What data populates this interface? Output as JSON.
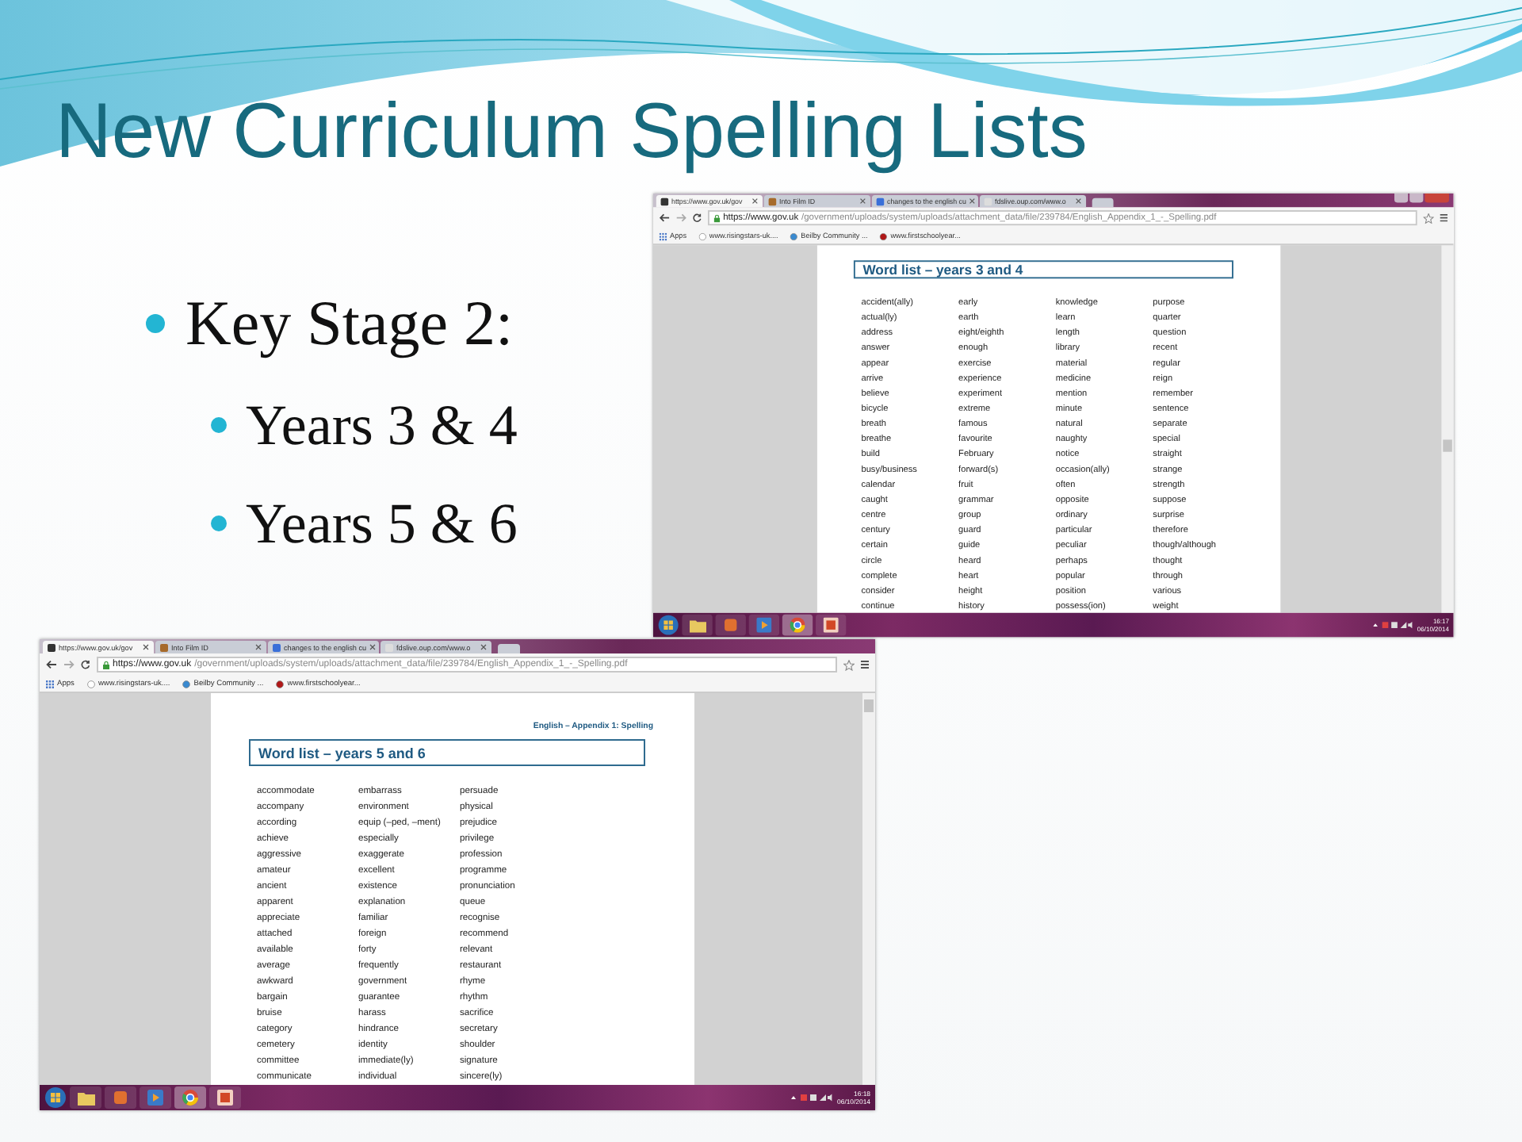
{
  "slide": {
    "title": "New Curriculum Spelling Lists",
    "bullets": [
      {
        "text": "Key Stage 2:",
        "children": [
          {
            "text": "Years 3 & 4"
          },
          {
            "text": "Years 5 & 6"
          }
        ]
      }
    ]
  },
  "screenshots": [
    {
      "window_controls": true,
      "tabs": [
        {
          "label": "https://www.gov.uk/gov",
          "selected": true
        },
        {
          "label": "Into Film ID",
          "selected": false
        },
        {
          "label": "changes to the english cu",
          "selected": false
        },
        {
          "label": "fdslive.oup.com/www.o",
          "selected": false
        }
      ],
      "url_host": "https://www.gov.uk",
      "url_path": "/government/uploads/system/uploads/attachment_data/file/239784/English_Appendix_1_-_Spelling.pdf",
      "bookmarks": [
        "Apps",
        "www.risingstars-uk....",
        "Beilby Community ...",
        "www.firstschoolyear..."
      ],
      "page": {
        "heading": "Word list – years 3 and 4",
        "columns": [
          [
            "accident(ally)",
            "actual(ly)",
            "address",
            "answer",
            "appear",
            "arrive",
            "believe",
            "bicycle",
            "breath",
            "breathe",
            "build",
            "busy/business",
            "calendar",
            "caught",
            "centre",
            "century",
            "certain",
            "circle",
            "complete",
            "consider",
            "continue"
          ],
          [
            "early",
            "earth",
            "eight/eighth",
            "enough",
            "exercise",
            "experience",
            "experiment",
            "extreme",
            "famous",
            "favourite",
            "February",
            "forward(s)",
            "fruit",
            "grammar",
            "group",
            "guard",
            "guide",
            "heard",
            "heart",
            "height",
            "history"
          ],
          [
            "knowledge",
            "learn",
            "length",
            "library",
            "material",
            "medicine",
            "mention",
            "minute",
            "natural",
            "naughty",
            "notice",
            "occasion(ally)",
            "often",
            "opposite",
            "ordinary",
            "particular",
            "peculiar",
            "perhaps",
            "popular",
            "position",
            "possess(ion)"
          ],
          [
            "purpose",
            "quarter",
            "question",
            "recent",
            "regular",
            "reign",
            "remember",
            "sentence",
            "separate",
            "special",
            "straight",
            "strange",
            "strength",
            "suppose",
            "surprise",
            "therefore",
            "though/although",
            "thought",
            "through",
            "various",
            "weight"
          ]
        ]
      },
      "taskbar": {
        "time": "16:17",
        "date": "06/10/2014"
      }
    },
    {
      "window_controls": false,
      "tabs": [
        {
          "label": "https://www.gov.uk/gov",
          "selected": true
        },
        {
          "label": "Into Film ID",
          "selected": false
        },
        {
          "label": "changes to the english cu",
          "selected": false
        },
        {
          "label": "fdslive.oup.com/www.o",
          "selected": false
        }
      ],
      "url_host": "https://www.gov.uk",
      "url_path": "/government/uploads/system/uploads/attachment_data/file/239784/English_Appendix_1_-_Spelling.pdf",
      "bookmarks": [
        "Apps",
        "www.risingstars-uk....",
        "Beilby Community ...",
        "www.firstschoolyear..."
      ],
      "page": {
        "header": "English – Appendix 1: Spelling",
        "heading": "Word list – years 5 and 6",
        "columns": [
          [
            "accommodate",
            "accompany",
            "according",
            "achieve",
            "aggressive",
            "amateur",
            "ancient",
            "apparent",
            "appreciate",
            "attached",
            "available",
            "average",
            "awkward",
            "bargain",
            "bruise",
            "category",
            "cemetery",
            "committee",
            "communicate"
          ],
          [
            "embarrass",
            "environment",
            "equip (–ped, –ment)",
            "especially",
            "exaggerate",
            "excellent",
            "existence",
            "explanation",
            "familiar",
            "foreign",
            "forty",
            "frequently",
            "government",
            "guarantee",
            "harass",
            "hindrance",
            "identity",
            "immediate(ly)",
            "individual"
          ],
          [
            "persuade",
            "physical",
            "prejudice",
            "privilege",
            "profession",
            "programme",
            "pronunciation",
            "queue",
            "recognise",
            "recommend",
            "relevant",
            "restaurant",
            "rhyme",
            "rhythm",
            "sacrifice",
            "secretary",
            "shoulder",
            "signature",
            "sincere(ly)"
          ]
        ]
      },
      "taskbar": {
        "time": "16:18",
        "date": "06/10/2014"
      }
    }
  ]
}
